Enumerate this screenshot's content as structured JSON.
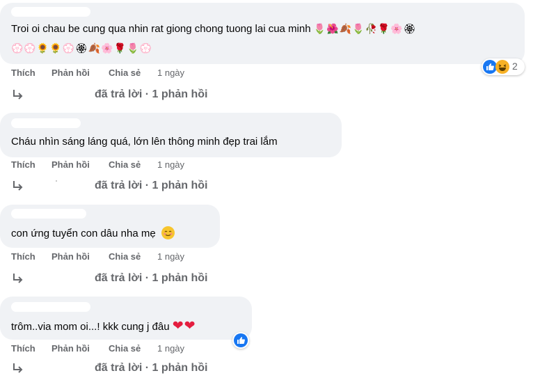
{
  "comments": [
    {
      "text_line1": "Troi oi chau be cung qua nhin rat giong chong tuong lai cua minh",
      "emoji_line1": "🌷🌺🍂🌷🥀🌹🌸🏵",
      "emoji_line2": "💮💮🌻🌻💮🏵🍂🌸🌹🌷💮",
      "actions": {
        "like": "Thích",
        "reply": "Phản hồi",
        "share": "Chia sẻ",
        "time": "1 ngày"
      },
      "replies": "đã trả lời · 1 phản hồi",
      "reaction_count": "2"
    },
    {
      "text": "Cháu nhìn sáng láng quá, lớn lên thông minh đẹp trai lắm",
      "actions": {
        "like": "Thích",
        "reply": "Phản hồi",
        "share": "Chia sẻ",
        "time": "1 ngày"
      },
      "replies": "đã trả lời · 1 phản hồi"
    },
    {
      "text": "con ứng tuyển con dâu nha mẹ",
      "emoji": "☺",
      "actions": {
        "like": "Thích",
        "reply": "Phản hồi",
        "share": "Chia sẻ",
        "time": "1 ngày"
      },
      "replies": "đã trả lời · 1 phản hồi"
    },
    {
      "text": "trôm..via mom oi...! kkk cung j đâu",
      "emoji": "❤❤",
      "actions": {
        "like": "Thích",
        "reply": "Phản hồi",
        "share": "Chia sẻ",
        "time": "1 ngày"
      },
      "replies": "đã trả lời · 1 phản hồi"
    }
  ],
  "colors": {
    "bubble": "#f0f2f5",
    "muted": "#65676b",
    "like_blue": "#1877f2",
    "haha_yellow": "#f7b125",
    "heart_red": "#e41e3f"
  },
  "icons": [
    "reply-arrow-icon",
    "like-reaction-icon",
    "haha-reaction-icon"
  ]
}
